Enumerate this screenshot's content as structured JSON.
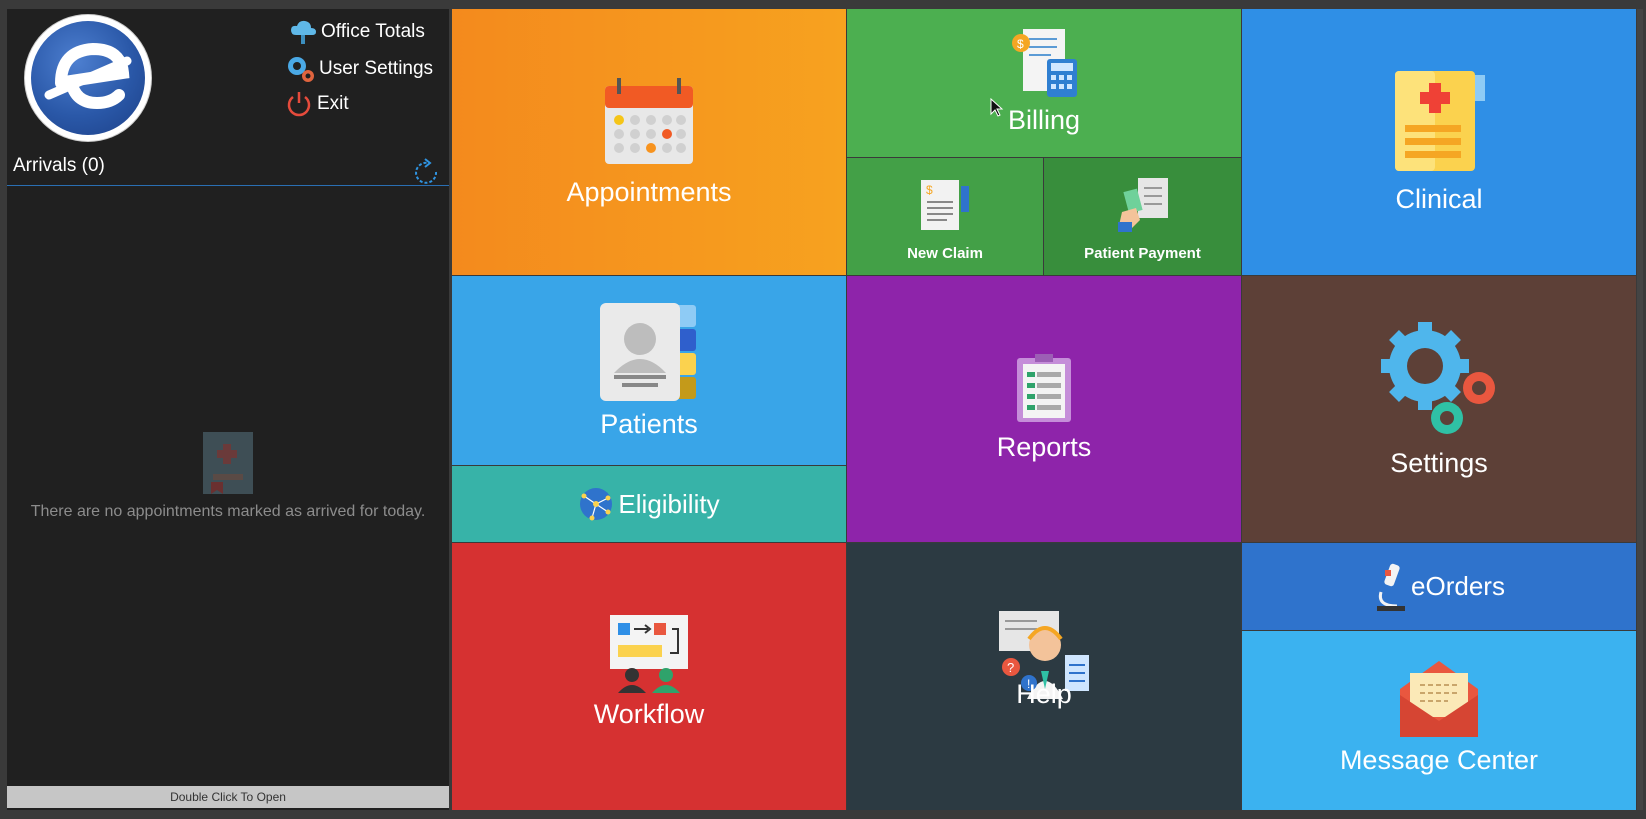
{
  "sidebar": {
    "links": {
      "office_totals": "Office Totals",
      "user_settings": "User Settings",
      "exit": "Exit"
    },
    "arrivals_title": "Arrivals (0)",
    "empty_message": "There are no appointments marked as arrived for today.",
    "open_hint": "Double Click To Open"
  },
  "tiles": {
    "appointments": "Appointments",
    "billing": "Billing",
    "new_claim": "New Claim",
    "patient_payment": "Patient Payment",
    "clinical": "Clinical",
    "patients": "Patients",
    "eligibility": "Eligibility",
    "reports": "Reports",
    "settings": "Settings",
    "workflow": "Workflow",
    "help": "Help",
    "eorders": "eOrders",
    "message_center": "Message Center"
  },
  "colors": {
    "appointments": "#f7921e",
    "billing": "#4caf50",
    "new_claim": "#43a047",
    "patient_payment": "#388e3c",
    "clinical": "#2f8fe6",
    "patients": "#39a5e8",
    "eligibility": "#37b3a8",
    "reports": "#8e24aa",
    "settings": "#5d4037",
    "workflow": "#d63131",
    "help": "#2c3a42",
    "eorders": "#2f73cc",
    "message_center": "#3bb2f0"
  }
}
